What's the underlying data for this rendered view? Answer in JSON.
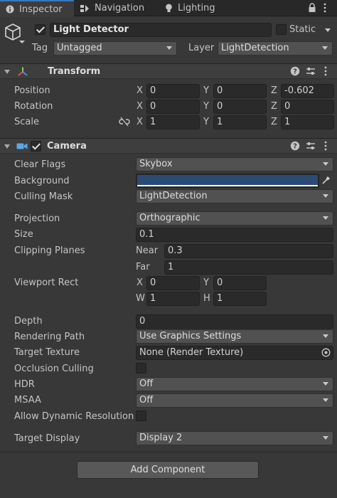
{
  "tabs": [
    {
      "label": "Inspector",
      "icon": "info-icon",
      "active": true
    },
    {
      "label": "Navigation",
      "icon": "navigation-icon",
      "active": false
    },
    {
      "label": "Lighting",
      "icon": "lightbulb-icon",
      "active": false
    }
  ],
  "gameobject": {
    "name": "Light Detector",
    "active": true,
    "static_label": "Static",
    "static": false,
    "tag_label": "Tag",
    "tag_value": "Untagged",
    "layer_label": "Layer",
    "layer_value": "LightDetection"
  },
  "transform": {
    "title": "Transform",
    "position_label": "Position",
    "rotation_label": "Rotation",
    "scale_label": "Scale",
    "axis_x": "X",
    "axis_y": "Y",
    "axis_z": "Z",
    "position": {
      "x": "0",
      "y": "0",
      "z": "-0.602"
    },
    "rotation": {
      "x": "0",
      "y": "0",
      "z": "0"
    },
    "scale": {
      "x": "1",
      "y": "1",
      "z": "1"
    }
  },
  "camera": {
    "title": "Camera",
    "enabled": true,
    "clear_flags_label": "Clear Flags",
    "clear_flags_value": "Skybox",
    "background_label": "Background",
    "background_color": "#2b4a75",
    "culling_mask_label": "Culling Mask",
    "culling_mask_value": "LightDetection",
    "projection_label": "Projection",
    "projection_value": "Orthographic",
    "size_label": "Size",
    "size_value": "0.1",
    "clipping_label": "Clipping Planes",
    "near_label": "Near",
    "near_value": "0.3",
    "far_label": "Far",
    "far_value": "1",
    "viewport_label": "Viewport Rect",
    "vp_x_label": "X",
    "vp_x": "0",
    "vp_y_label": "Y",
    "vp_y": "0",
    "vp_w_label": "W",
    "vp_w": "1",
    "vp_h_label": "H",
    "vp_h": "1",
    "depth_label": "Depth",
    "depth_value": "0",
    "rendering_path_label": "Rendering Path",
    "rendering_path_value": "Use Graphics Settings",
    "target_texture_label": "Target Texture",
    "target_texture_value": "None (Render Texture)",
    "occlusion_label": "Occlusion Culling",
    "occlusion_checked": false,
    "hdr_label": "HDR",
    "hdr_value": "Off",
    "msaa_label": "MSAA",
    "msaa_value": "Off",
    "dynamic_res_label": "Allow Dynamic Resolution",
    "dynamic_res_checked": false,
    "target_display_label": "Target Display",
    "target_display_value": "Display 2"
  },
  "add_component_label": "Add Component",
  "colors": {
    "accent": "#3a79bb",
    "camera_icon": "#5aa8e6"
  }
}
